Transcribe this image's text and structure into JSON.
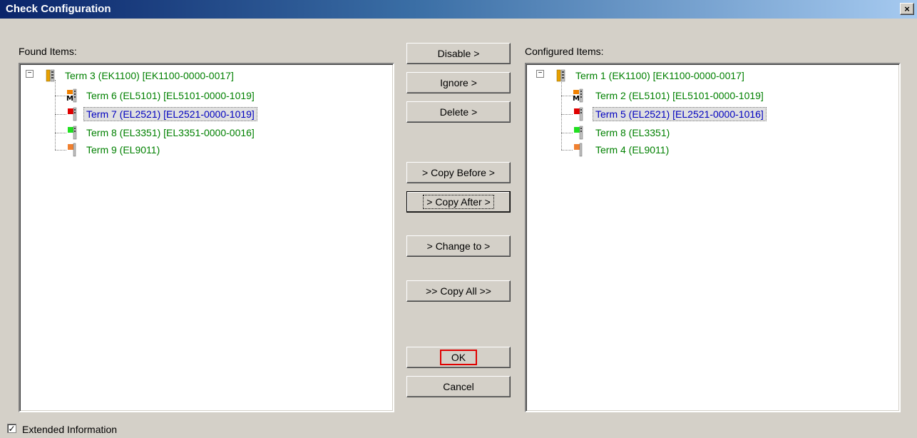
{
  "window": {
    "title": "Check Configuration",
    "close_glyph": "×"
  },
  "found": {
    "label": "Found Items:",
    "items": [
      {
        "text": "Term 3 (EK1100)   [EK1100-0000-0017]",
        "icon": "coupler-icon",
        "root": true
      },
      {
        "text": "Term 6 (EL5101)   [EL5101-0000-1019]",
        "icon": "terminal-orange-m-icon"
      },
      {
        "text": "Term 7 (EL2521)   [EL2521-0000-1019]",
        "icon": "terminal-red-icon",
        "selected": true
      },
      {
        "text": "Term 8 (EL3351)   [EL3351-0000-0016]",
        "icon": "terminal-green-icon"
      },
      {
        "text": "Term 9 (EL9011)",
        "icon": "terminal-end-icon"
      }
    ]
  },
  "configured": {
    "label": "Configured Items:",
    "items": [
      {
        "text": "Term 1 (EK1100)   [EK1100-0000-0017]",
        "icon": "coupler-icon",
        "root": true
      },
      {
        "text": "Term 2 (EL5101)   [EL5101-0000-1019]",
        "icon": "terminal-orange-m-icon"
      },
      {
        "text": "Term 5 (EL2521)   [EL2521-0000-1016]",
        "icon": "terminal-red-icon",
        "selected": true
      },
      {
        "text": "Term 8 (EL3351)",
        "icon": "terminal-green-icon"
      },
      {
        "text": "Term 4 (EL9011)",
        "icon": "terminal-end-icon"
      }
    ]
  },
  "buttons": {
    "disable": "Disable >",
    "ignore": "Ignore >",
    "delete": "Delete >",
    "copy_before": "> Copy Before >",
    "copy_after": "> Copy After >",
    "change_to": "> Change to >",
    "copy_all": ">> Copy All >>",
    "ok": "OK",
    "cancel": "Cancel"
  },
  "options": {
    "extended_info_label": "Extended Information",
    "extended_info_checked": true,
    "check_glyph": "✓"
  },
  "colors": {
    "item_text": "#008000",
    "selected_text": "#0000c0",
    "title_start": "#0a246a",
    "title_end": "#a6caf0",
    "ok_highlight": "#e00000"
  }
}
